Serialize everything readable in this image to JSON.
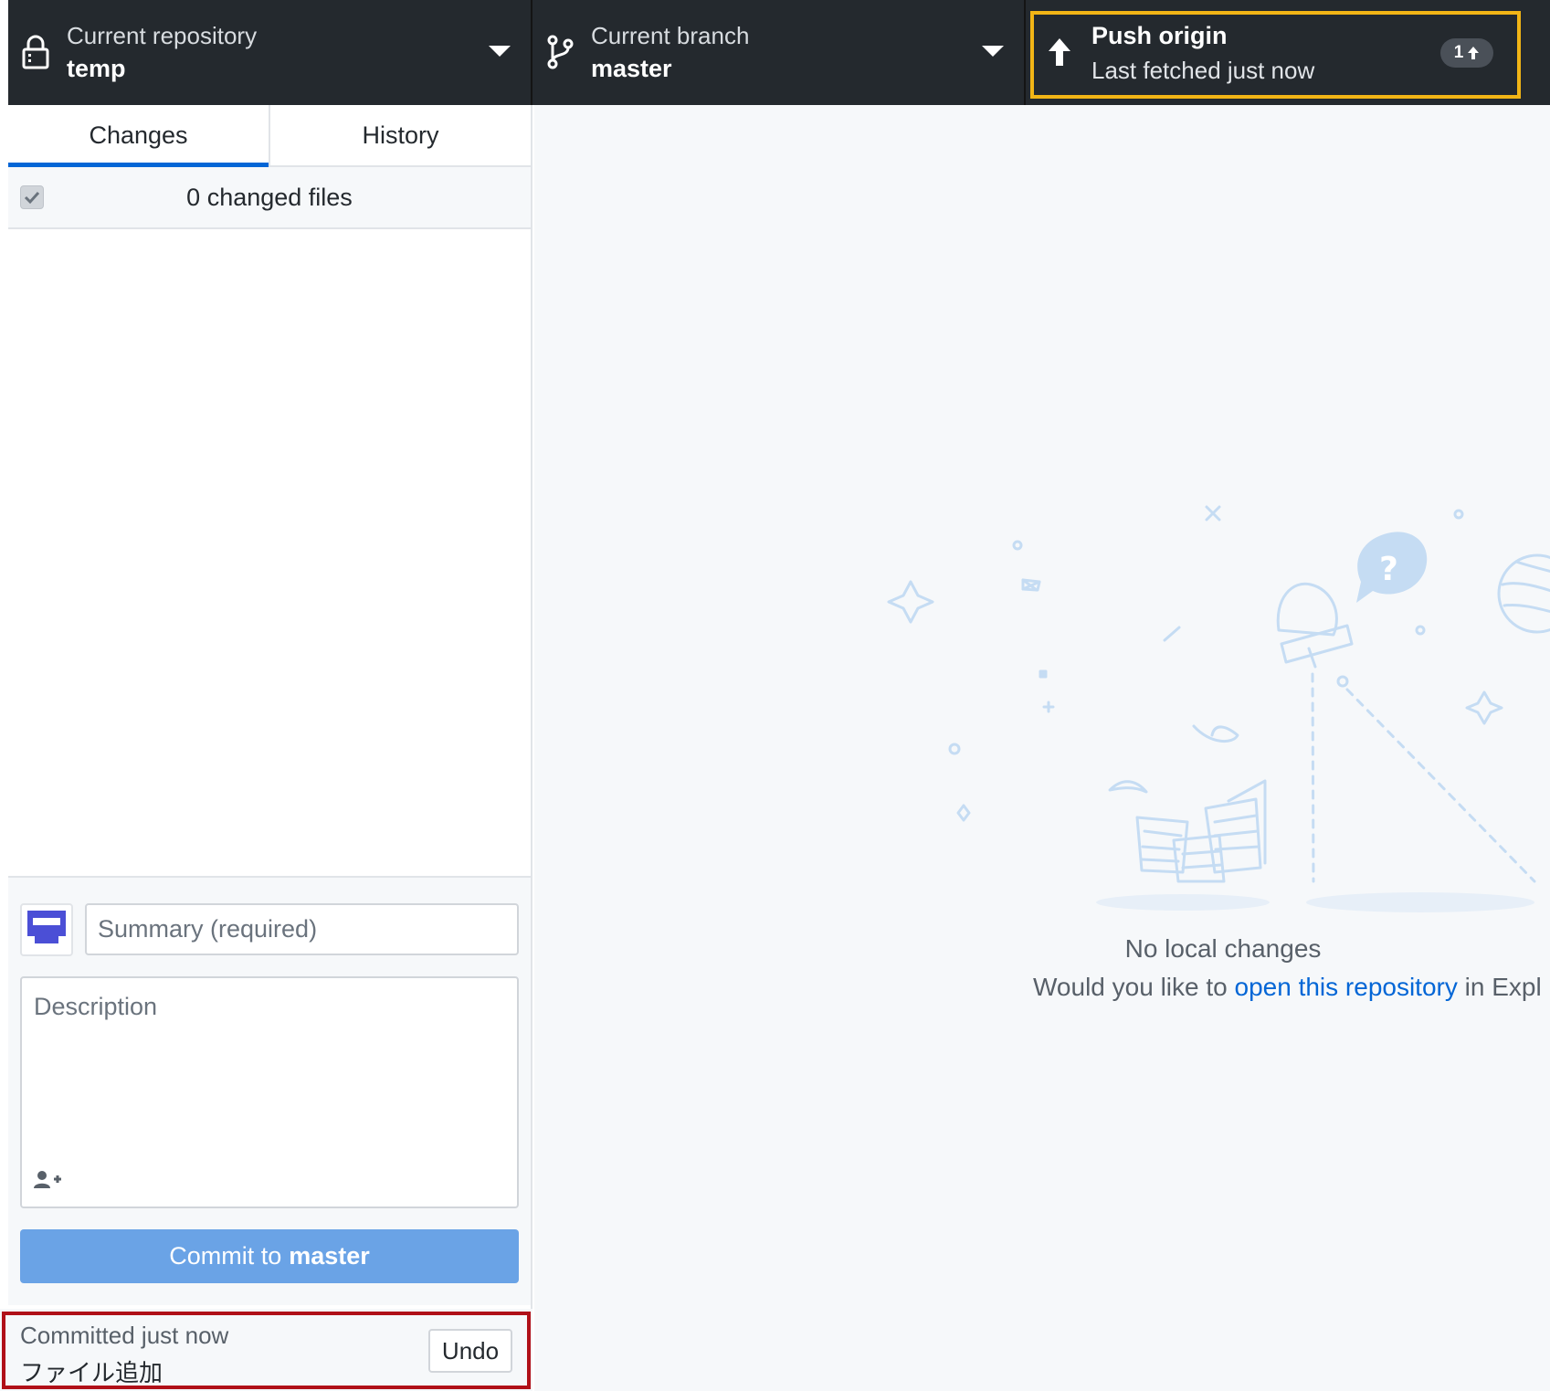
{
  "toolbar": {
    "repository": {
      "label": "Current repository",
      "value": "temp"
    },
    "branch": {
      "label": "Current branch",
      "value": "master"
    },
    "push": {
      "label": "Push origin",
      "subtitle": "Last fetched just now",
      "ahead_count": "1"
    }
  },
  "tabs": [
    {
      "label": "Changes",
      "active": true
    },
    {
      "label": "History",
      "active": false
    }
  ],
  "changes": {
    "header": "0 changed files"
  },
  "commit": {
    "summary_placeholder": "Summary (required)",
    "description_placeholder": "Description",
    "button_prefix": "Commit to",
    "button_branch": "master"
  },
  "undo": {
    "time": "Committed just now",
    "message": "ファイル追加",
    "button": "Undo"
  },
  "blank_slate": {
    "title": "No local changes",
    "subtitle_before": "Would you like to",
    "subtitle_link": "open this repository",
    "subtitle_after": "in Expl"
  },
  "colors": {
    "toolbar_bg": "#24292e",
    "push_highlight": "#f2b516",
    "undo_highlight": "#b01018",
    "tab_active": "#0366d6",
    "commit_button": "#6aa3e6",
    "link": "#0366d6"
  },
  "icons": [
    "lock-icon",
    "branch-icon",
    "caret-down-icon",
    "arrow-up-icon",
    "checkbox-icon",
    "avatar-icon",
    "add-coauthor-icon"
  ]
}
